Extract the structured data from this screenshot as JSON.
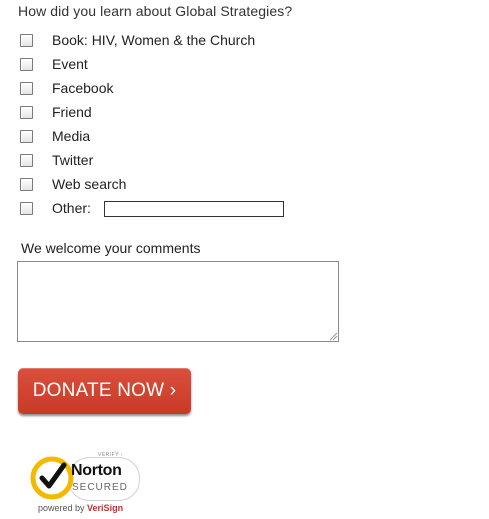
{
  "form": {
    "question": "How did you learn about Global Strategies?",
    "options": [
      {
        "label": "Book: HIV, Women & the Church",
        "checked": false
      },
      {
        "label": "Event",
        "checked": false
      },
      {
        "label": "Facebook",
        "checked": false
      },
      {
        "label": "Friend",
        "checked": false
      },
      {
        "label": "Media",
        "checked": false
      },
      {
        "label": "Twitter",
        "checked": false
      },
      {
        "label": "Web search",
        "checked": false
      },
      {
        "label": "Other:",
        "checked": false
      }
    ],
    "other_value": "",
    "comments_label": "We welcome your comments",
    "comments_value": ""
  },
  "donate": {
    "label": "DONATE NOW ›",
    "color": "#d0442f"
  },
  "badge": {
    "verify": "VERIFY ›",
    "name": "Norton",
    "secured": "SECURED",
    "powered_by": "powered by",
    "verisign": "VeriSign",
    "seal_color": "#f5b800"
  }
}
